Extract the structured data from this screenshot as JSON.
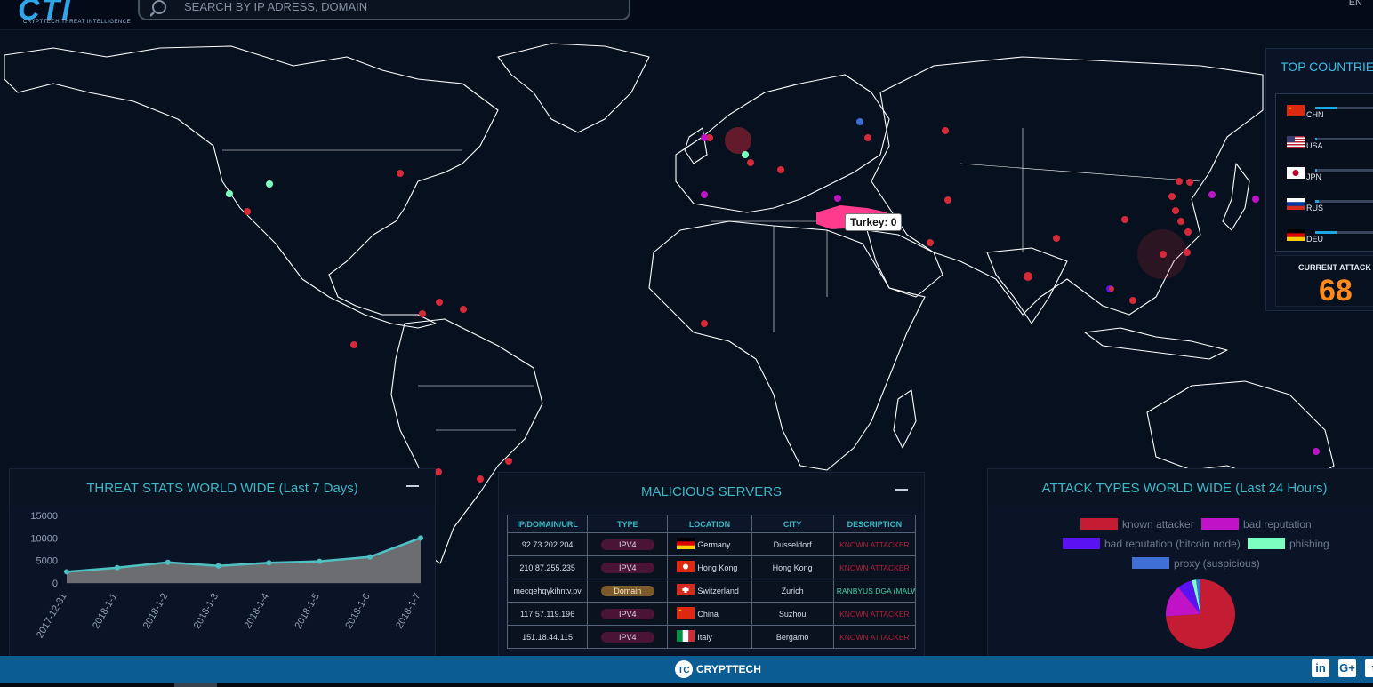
{
  "header": {
    "logo": "CTI",
    "logo_subtitle": "CRYPTTECH THREAT INTELLIGENCE",
    "search_placeholder": "SEARCH BY IP ADRESS, DOMAIN",
    "language": "EN"
  },
  "map": {
    "tooltip": "Turkey: 0",
    "highlighted_country": "Turkey",
    "colors": {
      "background": "#07101f",
      "land_outline": "#ffffff",
      "highlight": "#ff3b8d",
      "known_attacker": "#d42a3a",
      "bad_reputation": "#c012c6",
      "bitcoin_node": "#5b12f2",
      "phishing": "#7dffc1",
      "proxy": "#3f6fd4"
    }
  },
  "top_countries": {
    "title": "TOP COUNTRIES",
    "items": [
      {
        "code": "CHN",
        "flag": "china-flag-icon",
        "level": 0.3
      },
      {
        "code": "USA",
        "flag": "usa-flag-icon",
        "level": 0.0
      },
      {
        "code": "JPN",
        "flag": "japan-flag-icon",
        "level": 0.0
      },
      {
        "code": "RUS",
        "flag": "russia-flag-icon",
        "level": 0.05
      },
      {
        "code": "DEU",
        "flag": "germany-flag-icon",
        "level": 0.3
      }
    ],
    "current_attack_label": "CURRENT ATTACK",
    "current_attack_value": "68"
  },
  "threat_stats": {
    "title": "THREAT STATS WORLD WIDE (Last 7 Days)"
  },
  "chart_data": {
    "type": "area",
    "title": "THREAT STATS WORLD WIDE (Last 7 Days)",
    "x": [
      "2017-12-31",
      "2018-1-1",
      "2018-1-2",
      "2018-1-3",
      "2018-1-4",
      "2018-1-5",
      "2018-1-6",
      "2018-1-7"
    ],
    "values": [
      2500,
      3400,
      4600,
      3800,
      4500,
      4800,
      5800,
      10000
    ],
    "y_ticks": [
      "0",
      "5000",
      "10000",
      "15000"
    ],
    "ylim": [
      0,
      15000
    ],
    "grid": false,
    "colors": {
      "line": "#4ec2c2",
      "fill": "#6b6d70"
    }
  },
  "malicious_servers": {
    "title": "MALICIOUS SERVERS",
    "columns": [
      "IP/DOMAIN/URL",
      "TYPE",
      "LOCATION",
      "CITY",
      "DESCRIPTION"
    ],
    "rows": [
      {
        "ip": "92.73.202.204",
        "type": "IPV4",
        "location": "Germany",
        "flag": "germany-flag-icon",
        "city": "Dusseldorf",
        "description": "KNOWN ATTACKER"
      },
      {
        "ip": "210.87.255.235",
        "type": "IPV4",
        "location": "Hong Kong",
        "flag": "hongkong-flag-icon",
        "city": "Hong Kong",
        "description": "KNOWN ATTACKER"
      },
      {
        "ip": "mecqehqykihntv.pv",
        "type": "Domain",
        "location": "Switzerland",
        "flag": "switzerland-flag-icon",
        "city": "Zurich",
        "description": "RANBYUS DGA (MALWARE)"
      },
      {
        "ip": "117.57.119.196",
        "type": "IPV4",
        "location": "China",
        "flag": "china-flag-icon",
        "city": "Suzhou",
        "description": "KNOWN ATTACKER"
      },
      {
        "ip": "151.18.44.115",
        "type": "IPV4",
        "location": "Italy",
        "flag": "italy-flag-icon",
        "city": "Bergamo",
        "description": "KNOWN ATTACKER"
      }
    ]
  },
  "attack_types": {
    "title": "ATTACK TYPES WORLD WIDE (Last 24 Hours)",
    "legend": [
      {
        "label": "known attacker",
        "color": "#c41c33"
      },
      {
        "label": "bad reputation",
        "color": "#c012c6"
      },
      {
        "label": "bad reputation (bitcoin node)",
        "color": "#5b12f2"
      },
      {
        "label": "phishing",
        "color": "#7dffc1"
      },
      {
        "label": "proxy (suspicious)",
        "color": "#3f6fd4"
      }
    ],
    "pie_values": [
      74,
      15,
      7,
      2,
      2
    ]
  },
  "footer": {
    "brand": "CRYPTTECH",
    "social": [
      {
        "name": "linkedin",
        "text": "in"
      },
      {
        "name": "google-plus",
        "text": "G+"
      },
      {
        "name": "twitter",
        "text": "t"
      }
    ]
  }
}
